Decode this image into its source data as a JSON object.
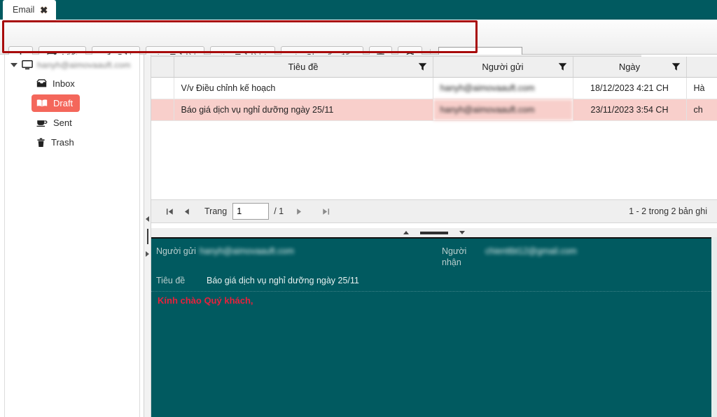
{
  "tab": {
    "label": "Email",
    "close_icon": "close-icon",
    "close_glyph": "✖"
  },
  "toolbar": {
    "buttons": [
      {
        "name": "download-button",
        "icon": "download-icon",
        "label": ""
      },
      {
        "name": "compose-button",
        "icon": "pencil-square-icon",
        "label": "Viết"
      },
      {
        "name": "send-button",
        "icon": "paper-plane-icon",
        "label": "Gửi"
      },
      {
        "name": "reply-button",
        "icon": "reply-icon",
        "label": "Trả lời"
      },
      {
        "name": "reply-all-button",
        "icon": "reply-all-icon",
        "label": "Trả lời *"
      },
      {
        "name": "forward-button",
        "icon": "forward-arrow-icon",
        "label": "Chuyển đến"
      },
      {
        "name": "delete-button",
        "icon": "trash-icon",
        "label": ""
      },
      {
        "name": "refresh-button",
        "icon": "refresh-icon",
        "label": ""
      }
    ],
    "search": {
      "value": "",
      "placeholder": ""
    },
    "highlight_color": "#a80b0b"
  },
  "sidebar": {
    "account": "hanyh@aimovaauft.com",
    "account_blurred": true,
    "items": [
      {
        "label": "Inbox",
        "icon": "inbox-icon",
        "active": false
      },
      {
        "label": "Draft",
        "icon": "book-icon",
        "active": true
      },
      {
        "label": "Sent",
        "icon": "sent-icon",
        "active": false
      },
      {
        "label": "Trash",
        "icon": "trash-icon",
        "active": false
      }
    ],
    "active_color": "#F4675B"
  },
  "grid": {
    "columns": [
      {
        "key": "sel",
        "label": "",
        "filter": false
      },
      {
        "key": "subject",
        "label": "Tiêu đề",
        "filter": true
      },
      {
        "key": "sender",
        "label": "Người gửi",
        "filter": true
      },
      {
        "key": "date",
        "label": "Ngày",
        "filter": true
      },
      {
        "key": "extra",
        "label": "",
        "filter": false
      }
    ],
    "rows": [
      {
        "subject": "V/v Điều chỉnh kế hoạch",
        "sender": "hanyh@aimovaauft.com",
        "sender_blurred": true,
        "date": "18/12/2023 4:21 CH",
        "extra": "Hà",
        "selected": false
      },
      {
        "subject": "Báo giá dịch vụ nghỉ dưỡng ngày 25/11",
        "sender": "hanyh@aimovaauft.com",
        "sender_blurred": true,
        "date": "23/11/2023 3:54 CH",
        "extra": "ch",
        "selected": true
      }
    ],
    "selected_row_color": "#F8CFCB"
  },
  "pager": {
    "first_icon": "first-page-icon",
    "prev_icon": "prev-page-icon",
    "next_icon": "next-page-icon",
    "last_icon": "last-page-icon",
    "page_label": "Trang",
    "page_value": "1",
    "page_total": "/ 1",
    "summary": "1 - 2 trong 2 bản ghi"
  },
  "detail": {
    "from_label": "Người gửi",
    "from_value": "hanyh@aimovaauft.com",
    "from_blurred": true,
    "to_label": "Người nhận",
    "to_value": "chienttbt12@gmail.com",
    "to_blurred": true,
    "subject_label": "Tiêu đề",
    "subject_value": "Báo giá dịch vụ nghỉ dưỡng ngày 25/11",
    "body": "Kính chào Quý khách,",
    "background_color": "#015A60",
    "body_color": "#E8213C"
  }
}
